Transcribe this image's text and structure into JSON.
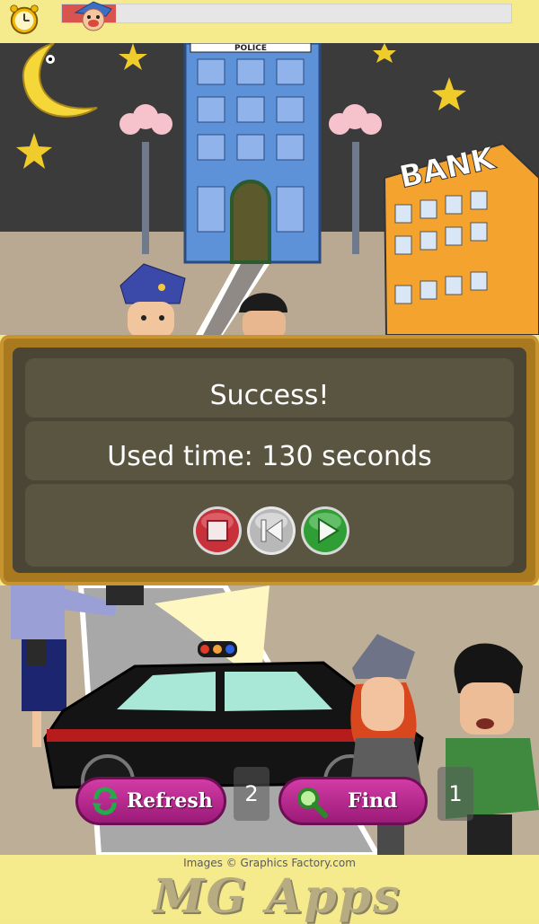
{
  "top_bar": {
    "icons": [
      "alarm-clock-icon",
      "police-face-icon"
    ],
    "progress_fraction": 0.12,
    "colors": {
      "progress_fill": "#d9534f",
      "progress_track": "#e6e6e6"
    }
  },
  "scene_top": {
    "police_sign": "POLICE",
    "bank_sign": "BANK"
  },
  "dialog": {
    "title": "Success!",
    "message": "Used time: 130 seconds",
    "buttons": [
      {
        "icon": "stop-icon",
        "color": "#c8303a"
      },
      {
        "icon": "rewind-icon",
        "color": "#b8b8b8"
      },
      {
        "icon": "play-icon",
        "color": "#2f9e35"
      }
    ]
  },
  "controls": {
    "refresh_label": "Refresh",
    "refresh_count": "2",
    "find_label": "Find",
    "find_count": "1"
  },
  "footer": {
    "credit": "Images © Graphics Factory.com",
    "brand": "MG Apps"
  }
}
